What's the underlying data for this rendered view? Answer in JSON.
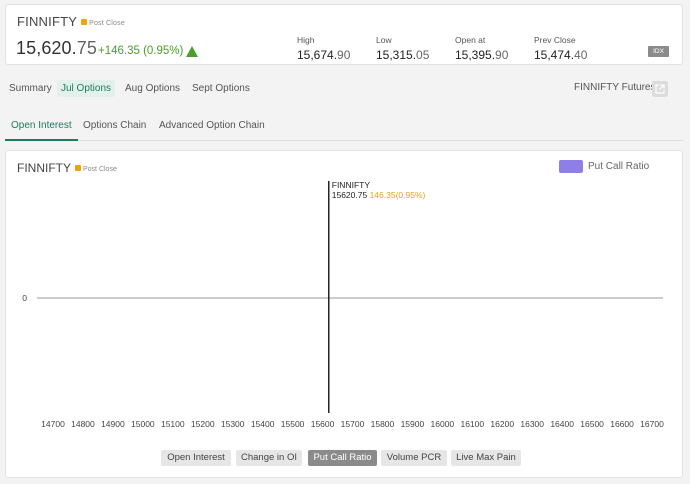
{
  "quote": {
    "symbol": "FINNIFTY",
    "status": "Post Close",
    "price_int": "15,620.",
    "price_dec": "75",
    "change": "+146.35 (0.95%)",
    "stats": [
      {
        "label": "High",
        "int": "15,674.",
        "dec": "90"
      },
      {
        "label": "Low",
        "int": "15,315.",
        "dec": "05"
      },
      {
        "label": "Open at",
        "int": "15,395.",
        "dec": "90"
      },
      {
        "label": "Prev Close",
        "int": "15,474.",
        "dec": "40"
      }
    ],
    "badge": "IDX",
    "colors": {
      "up": "#4b9e2c",
      "status_dot": "#f0a30a"
    }
  },
  "expiry_tabs": [
    {
      "label": "Summary",
      "active": false
    },
    {
      "label": "Jul Options",
      "active": true
    },
    {
      "label": "Aug Options",
      "active": false
    },
    {
      "label": "Sept Options",
      "active": false
    }
  ],
  "futures_link": {
    "label": "FINNIFTY Futures",
    "icon": "external-link-icon"
  },
  "sub_tabs": [
    {
      "label": "Open Interest",
      "active": true
    },
    {
      "label": "Options Chain",
      "active": false
    },
    {
      "label": "Advanced Option Chain",
      "active": false
    }
  ],
  "chart_panel": {
    "symbol": "FINNIFTY",
    "status": "Post Close",
    "legend": "Put Call Ratio",
    "legend_color": "#8d7fe6",
    "buttons": [
      {
        "label": "Open Interest",
        "active": false
      },
      {
        "label": "Change in OI",
        "active": false
      },
      {
        "label": "Put Call Ratio",
        "active": true
      },
      {
        "label": "Volume PCR",
        "active": false
      },
      {
        "label": "Live Max Pain",
        "active": false
      }
    ]
  },
  "chart_data": {
    "type": "bar",
    "categories": [
      14700,
      14800,
      14900,
      15000,
      15100,
      15200,
      15300,
      15400,
      15500,
      15600,
      15700,
      15800,
      15900,
      16000,
      16100,
      16200,
      16300,
      16400,
      16500,
      16600,
      16700
    ],
    "series": [
      {
        "name": "Put Call Ratio",
        "values": []
      }
    ],
    "y_ticks": [
      0
    ],
    "spot_marker": {
      "x": 15620.75,
      "label": "FINNIFTY",
      "price": "15620.75",
      "change": "146.35(0.95%)"
    },
    "legend_position": "top-right",
    "grid": false
  }
}
